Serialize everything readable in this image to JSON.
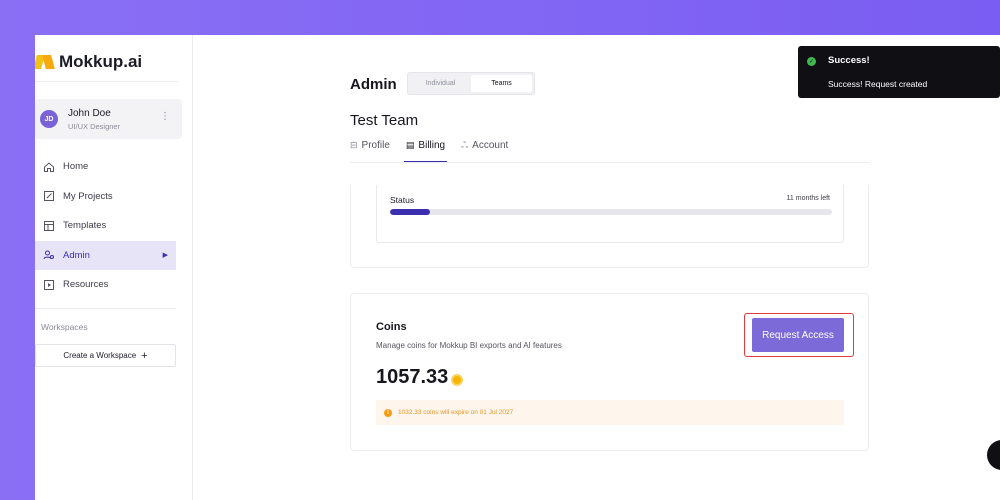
{
  "brand": {
    "name": "Mokkup.ai"
  },
  "user": {
    "initials": "JD",
    "name": "John Doe",
    "role": "UI/UX Designer"
  },
  "sidebar": {
    "items": [
      {
        "label": "Home",
        "icon": "home-icon"
      },
      {
        "label": "My Projects",
        "icon": "edit-icon"
      },
      {
        "label": "Templates",
        "icon": "template-icon"
      },
      {
        "label": "Admin",
        "icon": "admin-icon",
        "active": true
      },
      {
        "label": "Resources",
        "icon": "play-icon"
      }
    ],
    "workspaces_label": "Workspaces",
    "create_workspace": "Create a Workspace"
  },
  "header": {
    "title": "Admin",
    "segments": [
      "Individual",
      "Teams"
    ],
    "active_segment": "Teams"
  },
  "team": {
    "name": "Test Team",
    "tabs": [
      {
        "label": "Profile",
        "icon": "profile-icon"
      },
      {
        "label": "Billing",
        "icon": "billing-icon",
        "active": true
      },
      {
        "label": "Account",
        "icon": "account-icon"
      }
    ]
  },
  "status_card": {
    "label": "Status",
    "remaining": "11 months left",
    "progress_percent": 9
  },
  "coins_card": {
    "title": "Coins",
    "description": "Manage coins for Mokkup BI exports and AI features",
    "value": "1057.33",
    "request_button": "Request Access",
    "expire_notice": "1032.33 coins will expire on 01 Jul 2027"
  },
  "toast": {
    "title": "Success!",
    "message": "Success! Request created"
  },
  "colors": {
    "accent": "#3b2fb0",
    "button": "#7b6ad8",
    "background": "#8a6ff5",
    "success": "#3fb950",
    "warning": "#f39c12"
  }
}
